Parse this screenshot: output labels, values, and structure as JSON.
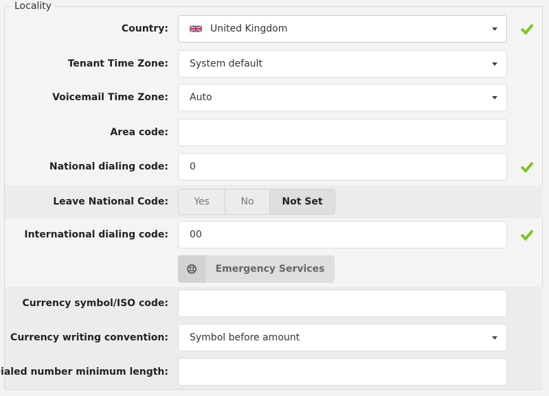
{
  "section": {
    "legend": "Locality"
  },
  "colors": {
    "valid_check": "#76c81d"
  },
  "fields": {
    "country": {
      "label": "Country:",
      "value": "United Kingdom",
      "flag": "uk-flag-icon",
      "valid": true
    },
    "tenant_tz": {
      "label": "Tenant Time Zone:",
      "value": "System default"
    },
    "voicemail_tz": {
      "label": "Voicemail Time Zone:",
      "value": "Auto"
    },
    "area_code": {
      "label": "Area code:",
      "value": ""
    },
    "national_code": {
      "label": "National dialing code:",
      "value": "0",
      "valid": true
    },
    "leave_national": {
      "label": "Leave National Code:",
      "options": [
        "Yes",
        "No",
        "Not Set"
      ],
      "selected": "Not Set"
    },
    "international_code": {
      "label": "International dialing code:",
      "value": "00",
      "valid": true
    },
    "emergency": {
      "label": "Emergency Services",
      "icon": "lifebuoy-icon"
    },
    "currency_symbol": {
      "label": "Currency symbol/ISO code:",
      "value": ""
    },
    "currency_convention": {
      "label": "Currency writing convention:",
      "value": "Symbol before amount"
    },
    "min_length": {
      "label": "Dialed number minimum length:",
      "value": ""
    }
  }
}
